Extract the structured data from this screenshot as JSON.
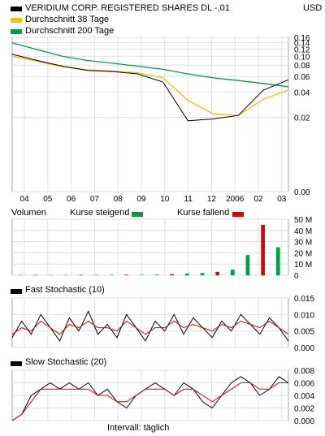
{
  "header": {
    "security_name": "VERIDIUM CORP. REGISTERED SHARES DL -,01",
    "currency": "USD",
    "legend": [
      {
        "label": "Durchschnitt 38 Tage",
        "color": "#f2c100"
      },
      {
        "label": "Durchschnitt 200 Tage",
        "color": "#00a040"
      }
    ],
    "price_line_color": "#000000"
  },
  "volume_legend": {
    "title": "Volumen",
    "up_label": "Kurse steigend",
    "up_color": "#00a040",
    "down_label": "Kurse fallend",
    "down_color": "#e00000"
  },
  "footer": {
    "interval": "Intervall: täglich"
  },
  "chart_data": [
    {
      "type": "line",
      "title": "VERIDIUM CORP. REGISTERED SHARES DL -,01",
      "y_scale": "log",
      "ylim": [
        0.0,
        0.16
      ],
      "y_ticks": [
        "0.16",
        "0.14",
        "0.12",
        "0.10",
        "0.08",
        "0.06",
        "0.04",
        "0.02",
        "0.00"
      ],
      "x_ticks": [
        "04",
        "05",
        "06",
        "07",
        "08",
        "09",
        "10",
        "11",
        "12",
        "2006",
        "02",
        "03"
      ],
      "x": [
        "04",
        "05",
        "06",
        "07",
        "08",
        "09",
        "10",
        "11",
        "12",
        "2006",
        "02",
        "03"
      ],
      "series": [
        {
          "name": "",
          "color": "#000000",
          "values": [
            0.105,
            0.09,
            0.078,
            0.07,
            0.068,
            0.064,
            0.052,
            0.018,
            0.019,
            0.021,
            0.042,
            0.055
          ]
        },
        {
          "name": "Durchschnitt 38 Tage",
          "color": "#f2c100",
          "values": [
            0.1,
            0.088,
            0.077,
            0.071,
            0.069,
            0.066,
            0.058,
            0.032,
            0.022,
            0.021,
            0.033,
            0.042
          ]
        },
        {
          "name": "Durchschnitt 200 Tage",
          "color": "#00a040",
          "values": [
            0.14,
            0.118,
            0.1,
            0.09,
            0.084,
            0.078,
            0.072,
            0.064,
            0.058,
            0.054,
            0.05,
            0.046
          ]
        }
      ]
    },
    {
      "type": "bar",
      "title": "Volumen",
      "ylim": [
        0,
        50
      ],
      "y_ticks": [
        "50 M",
        "40 M",
        "30 M",
        "20 M",
        "10 M",
        "0"
      ],
      "x_ticks": [
        "04",
        "05",
        "06",
        "07",
        "08",
        "09",
        "10",
        "11",
        "12",
        "2006",
        "02",
        "03"
      ],
      "values_m": [
        0.3,
        0.3,
        0.3,
        0.3,
        0.4,
        0.3,
        0.4,
        0.5,
        0.4,
        0.5,
        1.0,
        1.5,
        2.0,
        3.0,
        5.0,
        18.0,
        45.0,
        25.0
      ]
    },
    {
      "type": "line",
      "title": "Fast Stochastic (10)",
      "ylim": [
        0,
        0.015
      ],
      "y_ticks": [
        "0.015",
        "0.010",
        "0.005",
        "0.000"
      ],
      "series": [
        {
          "name": "",
          "color": "#000000",
          "values": [
            0.003,
            0.008,
            0.004,
            0.01,
            0.006,
            0.002,
            0.009,
            0.005,
            0.011,
            0.004,
            0.007,
            0.003,
            0.01,
            0.006,
            0.002,
            0.008,
            0.005,
            0.01,
            0.004,
            0.009,
            0.006,
            0.003,
            0.008,
            0.005,
            0.01,
            0.007,
            0.004,
            0.009,
            0.006,
            0.002
          ]
        },
        {
          "name": "",
          "color": "#e00000",
          "values": [
            0.004,
            0.006,
            0.005,
            0.008,
            0.006,
            0.004,
            0.007,
            0.006,
            0.008,
            0.006,
            0.006,
            0.005,
            0.008,
            0.006,
            0.004,
            0.006,
            0.006,
            0.008,
            0.006,
            0.007,
            0.006,
            0.005,
            0.007,
            0.006,
            0.008,
            0.007,
            0.006,
            0.008,
            0.006,
            0.004
          ]
        }
      ]
    },
    {
      "type": "line",
      "title": "Slow Stochastic (20)",
      "ylim": [
        0,
        0.008
      ],
      "y_ticks": [
        "0.008",
        "0.006",
        "0.004",
        "0.002",
        "0.000"
      ],
      "series": [
        {
          "name": "",
          "color": "#000000",
          "values": [
            0.0,
            0.001,
            0.004,
            0.005,
            0.006,
            0.005,
            0.006,
            0.005,
            0.006,
            0.004,
            0.005,
            0.003,
            0.002,
            0.004,
            0.005,
            0.006,
            0.005,
            0.004,
            0.006,
            0.005,
            0.003,
            0.002,
            0.004,
            0.006,
            0.007,
            0.006,
            0.004,
            0.005,
            0.007,
            0.006
          ]
        },
        {
          "name": "",
          "color": "#e00000",
          "values": [
            0.0,
            0.001,
            0.003,
            0.005,
            0.005,
            0.005,
            0.005,
            0.005,
            0.005,
            0.004,
            0.004,
            0.003,
            0.003,
            0.004,
            0.005,
            0.005,
            0.005,
            0.004,
            0.005,
            0.005,
            0.004,
            0.003,
            0.004,
            0.005,
            0.006,
            0.006,
            0.005,
            0.005,
            0.006,
            0.006
          ]
        }
      ]
    }
  ],
  "indicator_titles": {
    "fast": "Fast Stochastic (10)",
    "slow": "Slow Stochastic (20)"
  }
}
